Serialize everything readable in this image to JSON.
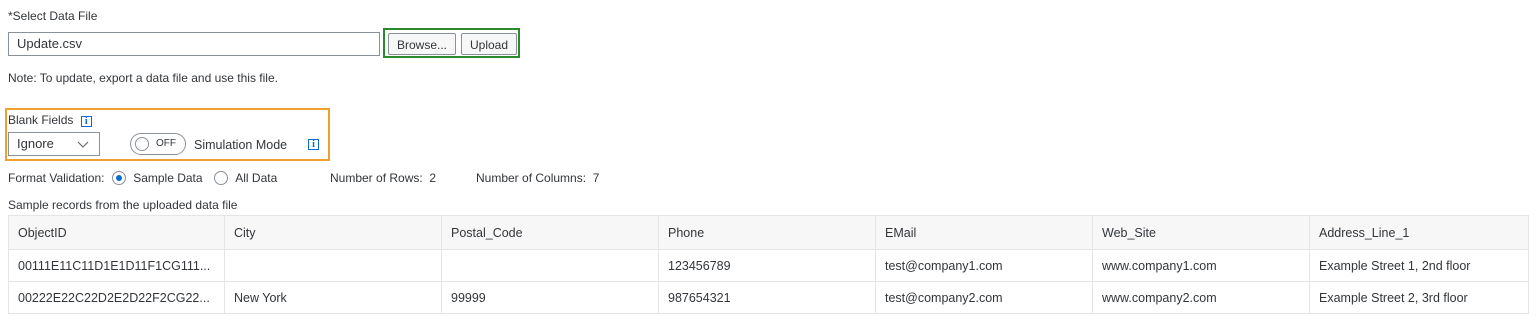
{
  "file": {
    "label": "*Select Data File",
    "value": "Update.csv",
    "browse_label": "Browse...",
    "upload_label": "Upload",
    "note": "Note: To update, export a data file and use this file."
  },
  "options": {
    "blank_fields_label": "Blank Fields",
    "blank_fields_value": "Ignore",
    "switch_state": "OFF",
    "simulation_label": "Simulation Mode",
    "info_glyph": "i"
  },
  "validation": {
    "label": "Format Validation:",
    "option_sample": "Sample Data",
    "option_all": "All Data",
    "selected": "Sample Data",
    "rows_text": "Number of Rows:  2",
    "cols_text": "Number of Columns:  7"
  },
  "table": {
    "caption": "Sample records from the uploaded data file",
    "headers": [
      "ObjectID",
      "City",
      "Postal_Code",
      "Phone",
      "EMail",
      "Web_Site",
      "Address_Line_1"
    ],
    "rows": [
      [
        "00111E11C11D1E1D11F1CG111...",
        "",
        "",
        "123456789",
        "test@company1.com",
        "www.company1.com",
        "Example Street 1, 2nd floor"
      ],
      [
        "00222E22C22D2E2D22F2CG22...",
        "New York",
        "99999",
        "987654321",
        "test@company2.com",
        "www.company2.com",
        "Example Street 2, 3rd floor"
      ]
    ]
  },
  "colors": {
    "upload_highlight": "#2b8a2b",
    "options_highlight": "#f0a030",
    "accent": "#0a6ed1"
  }
}
